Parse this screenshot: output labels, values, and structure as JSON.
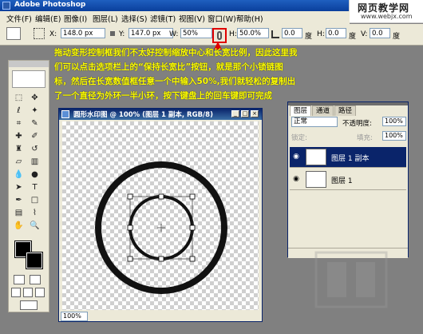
{
  "app": {
    "title": "Adobe Photoshop",
    "site_watermark_line1": "网页教学网",
    "site_watermark_line2": "www.webjx.com"
  },
  "menubar": [
    "文件(F)",
    "编辑(E)",
    "图像(I)",
    "图层(L)",
    "选择(S)",
    "滤镜(T)",
    "视图(V)",
    "窗口(W)",
    "帮助(H)"
  ],
  "options_bar": {
    "x_label": "X:",
    "x_value": "148.0 px",
    "y_label": "Y:",
    "y_value": "147.0 px",
    "w_label": "W:",
    "w_value": "50%",
    "h_label": "H:",
    "h_value": "50.0%",
    "angle_value": "0.0",
    "angle_unit": "度",
    "hskew_label": "H:",
    "hskew_value": "0.0",
    "vskew_label": "V:",
    "vskew_value": "0.0",
    "hskew_unit": "度",
    "vskew_unit": "度"
  },
  "annotation": {
    "line1": "拖动变形控制框我们不太好控制缩放中心和长宽比例，因此这里我",
    "line2": "们可以点击选项栏上的“保持长宽比”按钮，就是那个小锁链图",
    "line3": "标，然后在长宽数值框任意一个中输入50%,我们就轻松的复制出",
    "line4": "了一个直径为外环一半小环，按下键盘上的回车键即可完成"
  },
  "document": {
    "title": "圆形水印图 @ 100% (图层 1 副本, RGB/8)",
    "zoom": "100%"
  },
  "layers_panel": {
    "tabs": [
      "图层",
      "通道",
      "路径"
    ],
    "blend_mode": "正常",
    "opacity_label": "不透明度:",
    "opacity_value": "100%",
    "lock_label": "锁定:",
    "fill_label": "填充:",
    "fill_value": "100%",
    "layers": [
      {
        "name": "图层 1 副本",
        "selected": true
      },
      {
        "name": "图层 1",
        "selected": false
      }
    ]
  },
  "colors": {
    "accent_selected": "#0a246a",
    "annotation_text": "#ffff00",
    "highlight_box": "#e00000"
  },
  "icons": [
    "photoshop-logo-icon",
    "link-chain-icon",
    "eye-icon",
    "move-tool-icon",
    "lasso-tool-icon",
    "magic-wand-icon",
    "crop-icon",
    "brush-icon",
    "eraser-icon",
    "gradient-icon",
    "text-tool-icon",
    "pen-tool-icon",
    "hand-tool-icon",
    "zoom-tool-icon"
  ]
}
